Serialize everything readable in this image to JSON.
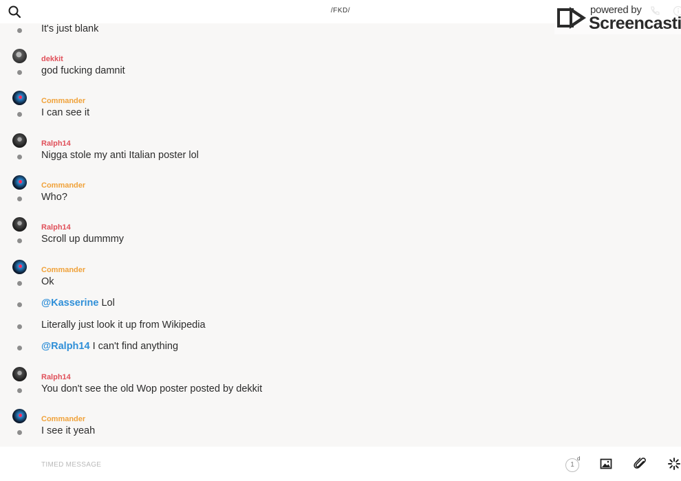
{
  "header": {
    "channel_title": "/FKD/"
  },
  "watermark": {
    "small_text": "powered by",
    "brand_text": "Screencastify"
  },
  "colors": {
    "username_red": "#e0505a",
    "username_orange": "#f0a23a",
    "mention_blue": "#2f8fd8"
  },
  "messages": [
    {
      "author": "",
      "text": "It's just blank"
    },
    {
      "author": "dekkit",
      "text": "god fucking damnit"
    },
    {
      "author": "Commander",
      "text": "I can see it"
    },
    {
      "author": "Ralph14",
      "text": "Nigga stole my anti Italian poster lol"
    },
    {
      "author": "Commander",
      "text": "Who?"
    },
    {
      "author": "Ralph14",
      "text": "Scroll up dummmy"
    },
    {
      "author": "Commander",
      "text": "Ok"
    },
    {
      "author": "",
      "mention": "@Kasserine",
      "text": " Lol"
    },
    {
      "author": "",
      "text": "Literally just look it up from Wikipedia"
    },
    {
      "author": "",
      "mention": "@Ralph14",
      "text": " I can't find anything"
    },
    {
      "author": "Ralph14",
      "text": "You don't see the old Wop poster posted by dekkit"
    },
    {
      "author": "Commander",
      "text": "I see it yeah"
    }
  ],
  "composer": {
    "placeholder": "TIMED MESSAGE",
    "timer_value": "1",
    "timer_unit": "d"
  },
  "icons": {
    "search": "search-icon",
    "phone": "phone-icon",
    "info": "info-icon",
    "image": "image-icon",
    "attach": "paperclip-icon",
    "spinner": "spinner-icon"
  }
}
